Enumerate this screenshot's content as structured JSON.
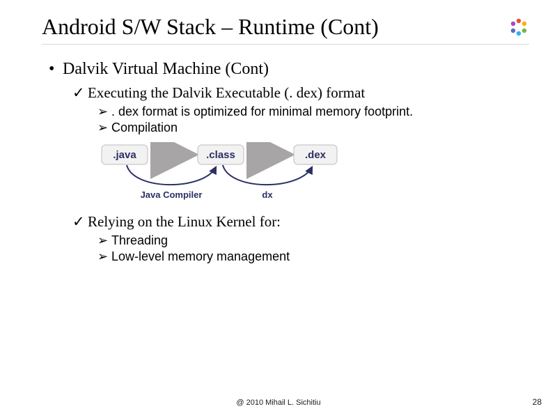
{
  "title": "Android S/W Stack – Runtime (Cont)",
  "bullets": {
    "l1_1": "Dalvik Virtual Machine (Cont)",
    "l2_1": "Executing the Dalvik Executable (. dex) format",
    "l3_1": ". dex format is optimized for minimal memory footprint.",
    "l3_2": "Compilation",
    "l2_2": "Relying on the Linux Kernel for:",
    "l3_3": "Threading",
    "l3_4": "Low-level memory management"
  },
  "diagram": {
    "box1": ".java",
    "box2": ".class",
    "box3": ".dex",
    "label1": "Java Compiler",
    "label2": "dx"
  },
  "footer": "@ 2010 Mihail L. Sichitiu",
  "page": "28",
  "marks": {
    "dot": "•",
    "check": "✓",
    "tri": "➢"
  }
}
